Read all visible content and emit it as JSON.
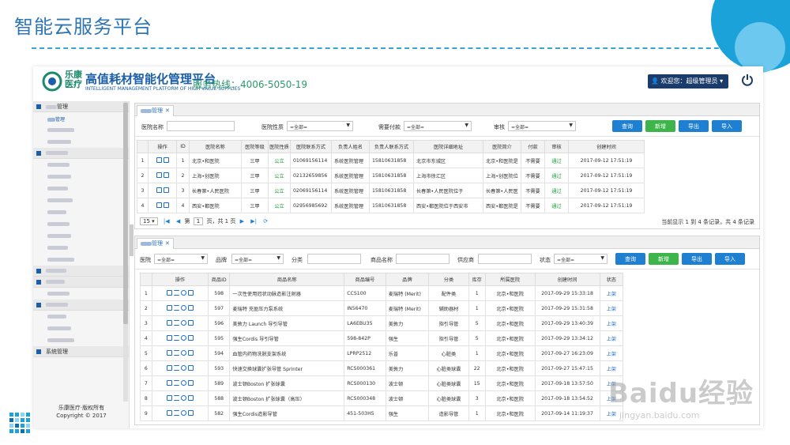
{
  "slide": {
    "title": "智能云服务平台",
    "watermark_main": "Baidu经验",
    "watermark_sub": "jingyan.baidu.com"
  },
  "header": {
    "logo_char_1": "乐康",
    "logo_char_2": "医疗",
    "logo_main": "高值耗材智能化管理平台",
    "logo_sub": "INTELLIGENT MANAGEMENT PLATFORM OF HIGH VALUE SUPPLIES",
    "hotline": "服务热线：4006-5050-19",
    "welcome": "欢迎您：超级管理员"
  },
  "sidebar": {
    "section_1": "管理",
    "active_item": "管理",
    "section_last": "系统管理",
    "footer_line1": "乐康医疗·版权所有",
    "footer_line2": "Copyright © 2017"
  },
  "hospital_panel": {
    "tab": "管理",
    "filters": {
      "name_label": "医院名称",
      "nature_label": "医院性质",
      "nature_value": "=全部=",
      "pay_label": "需要付款",
      "pay_value": "=全部=",
      "audit_label": "审核",
      "audit_value": "=全部="
    },
    "buttons": {
      "query": "查询",
      "add": "新增",
      "export": "导出",
      "import": "导入"
    },
    "columns": [
      "",
      "操作",
      "ID",
      "医院名称",
      "医院等级",
      "医院性质",
      "医院联系方式",
      "负责人姓名",
      "负责人联系方式",
      "医院详细地址",
      "医院简介",
      "付款",
      "审核",
      "创建时间"
    ],
    "rows": [
      {
        "n": "1",
        "id": "1",
        "name": "北京•和医院",
        "level": "三甲",
        "nature": "公立",
        "phone": "01069156114",
        "person": "系统医院管理",
        "person_phone": "15810631858",
        "addr": "北京市东城区",
        "intro": "北京•和医院是",
        "pay": "不需要",
        "audit": "通过",
        "time": "2017-09-12 17:51:19"
      },
      {
        "n": "2",
        "id": "2",
        "name": "上海•创医院",
        "level": "三甲",
        "nature": "公立",
        "phone": "02132659856",
        "person": "系统医院管理",
        "person_phone": "15810631858",
        "addr": "上海市徐汇区",
        "intro": "上海•创医院位",
        "pay": "不需要",
        "audit": "通过",
        "time": "2017-09-12 17:51:19"
      },
      {
        "n": "3",
        "id": "3",
        "name": "长春第•人民医院",
        "level": "三甲",
        "nature": "公立",
        "phone": "02069156114",
        "person": "系统医院管理",
        "person_phone": "15810631858",
        "addr": "长春第•人民医院位于",
        "intro": "长春第•人民医",
        "pay": "不需要",
        "audit": "通过",
        "time": "2017-09-12 17:51:19"
      },
      {
        "n": "4",
        "id": "4",
        "name": "西安•都医院",
        "level": "三甲",
        "nature": "公立",
        "phone": "02956985692",
        "person": "系统医院管理",
        "person_phone": "15810631858",
        "addr": "西安•都医院位于西安市",
        "intro": "西安•都医院是",
        "pay": "不需要",
        "audit": "通过",
        "time": "2017-09-12 17:51:19"
      }
    ],
    "pager": {
      "size": "15",
      "page_prefix": "第",
      "page": "1",
      "page_suffix": "页，共 1 页",
      "info": "当前显示 1 到 4 条记录，共 4 条记录"
    }
  },
  "product_panel": {
    "tab": "管理",
    "filters": {
      "hospital_label": "医院",
      "hospital_value": "=全部=",
      "brand_label": "品牌",
      "brand_value": "=全部=",
      "category_label": "分类",
      "product_label": "商品名称",
      "supplier_label": "供应商",
      "status_label": "状态",
      "status_value": "=全部="
    },
    "buttons": {
      "query": "查询",
      "add": "新增",
      "export": "导出",
      "import": "导入"
    },
    "columns": [
      "",
      "操作",
      "商品ID",
      "商品名称",
      "商品编号",
      "品牌",
      "分类",
      "库存",
      "所属医院",
      "创建时间",
      "状态"
    ],
    "rows": [
      {
        "n": "1",
        "id": "598",
        "name": "一次性使用冠状动脉造影注射器",
        "code": "CCS100",
        "brand": "麦瑞特 (Merit)",
        "cat": "配件类",
        "stock": "1",
        "hosp": "北京•和医院",
        "time": "2017-09-29 15:33:18",
        "status": "上架"
      },
      {
        "n": "2",
        "id": "597",
        "name": "麦瑞特 充盈压力泵系统",
        "code": "IN56470",
        "brand": "麦瑞特 (Merit)",
        "cat": "辅助器材",
        "stock": "1",
        "hosp": "北京•和医院",
        "time": "2017-09-29 15:31:58",
        "status": "上架"
      },
      {
        "n": "3",
        "id": "596",
        "name": "美敦力 Launch 导引导管",
        "code": "LA6EBU35",
        "brand": "美敦力",
        "cat": "指引导管",
        "stock": "5",
        "hosp": "北京•和医院",
        "time": "2017-09-29 13:40:39",
        "status": "上架"
      },
      {
        "n": "4",
        "id": "595",
        "name": "强生Cordis 导引导管",
        "code": "598-842P",
        "brand": "强生",
        "cat": "指引导管",
        "stock": "5",
        "hosp": "北京•和医院",
        "time": "2017-09-29 13:34:12",
        "status": "上架"
      },
      {
        "n": "5",
        "id": "594",
        "name": "血管内药物洗脱支架系统",
        "code": "LPRP2512",
        "brand": "乐普",
        "cat": "心脏类",
        "stock": "1",
        "hosp": "北京•和医院",
        "time": "2017-09-27 16:23:09",
        "status": "上架"
      },
      {
        "n": "6",
        "id": "593",
        "name": "快速交换球囊扩张导管 Sprinter",
        "code": "RCS000361",
        "brand": "美敦力",
        "cat": "心脏类球囊",
        "stock": "22",
        "hosp": "北京•和医院",
        "time": "2017-09-27 15:47:15",
        "status": "上架"
      },
      {
        "n": "7",
        "id": "589",
        "name": "波士顿Boston 扩张球囊",
        "code": "RCS000130",
        "brand": "波士顿",
        "cat": "心脏类球囊",
        "stock": "15",
        "hosp": "北京•和医院",
        "time": "2017-09-18 13:57:50",
        "status": "上架"
      },
      {
        "n": "8",
        "id": "588",
        "name": "波士顿Boston 扩张球囊（高压）",
        "code": "RCS000348",
        "brand": "波士顿",
        "cat": "心脏类球囊",
        "stock": "3",
        "hosp": "北京•和医院",
        "time": "2017-09-18 13:54:52",
        "status": "上架"
      },
      {
        "n": "9",
        "id": "582",
        "name": "强生Cordis造影导管",
        "code": "451-503H5",
        "brand": "强生",
        "cat": "造影导管",
        "stock": "1",
        "hosp": "北京•和医院",
        "time": "2017-09-14 11:19:37",
        "status": "上架"
      }
    ]
  }
}
